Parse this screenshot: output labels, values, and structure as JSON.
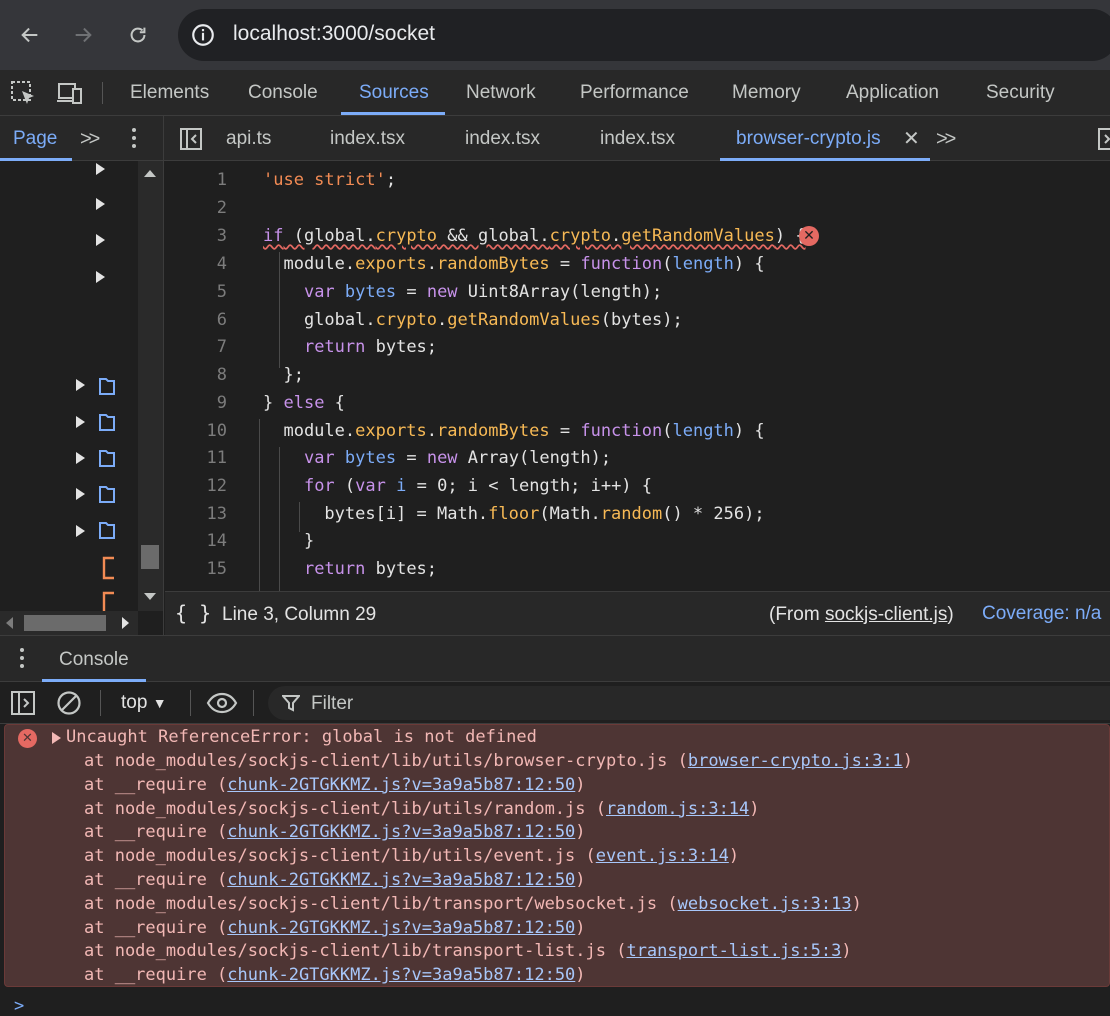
{
  "browser": {
    "url": "localhost:3000/socket"
  },
  "devtools": {
    "tabs": [
      "Elements",
      "Console",
      "Sources",
      "Network",
      "Performance",
      "Memory",
      "Application",
      "Security"
    ],
    "active_tab": "Sources"
  },
  "sources": {
    "navigator_tab": "Page",
    "open_files": [
      "api.ts",
      "index.tsx",
      "index.tsx",
      "index.tsx",
      "browser-crypto.js"
    ],
    "active_file": "browser-crypto.js"
  },
  "editor": {
    "line_numbers": [
      "1",
      "2",
      "3",
      "4",
      "5",
      "6",
      "7",
      "8",
      "9",
      "10",
      "11",
      "12",
      "13",
      "14",
      "15"
    ],
    "error_line": "3"
  },
  "status": {
    "braces": "{ }",
    "position": "Line 3, Column 29",
    "from_prefix": "(From ",
    "from_file": "sockjs-client.js",
    "from_suffix": ")",
    "coverage": "Coverage: n/a"
  },
  "drawer": {
    "tab": "Console",
    "context": "top",
    "filter_placeholder": "Filter"
  },
  "console": {
    "error_message": "Uncaught ReferenceError: global is not defined",
    "stack": [
      {
        "text": "at node_modules/sockjs-client/lib/utils/browser-crypto.js (",
        "link": "browser-crypto.js:3:1",
        "end": ")"
      },
      {
        "text": "at __require (",
        "link": "chunk-2GTGKKMZ.js?v=3a9a5b87:12:50",
        "end": ")"
      },
      {
        "text": "at node_modules/sockjs-client/lib/utils/random.js (",
        "link": "random.js:3:14",
        "end": ")"
      },
      {
        "text": "at __require (",
        "link": "chunk-2GTGKKMZ.js?v=3a9a5b87:12:50",
        "end": ")"
      },
      {
        "text": "at node_modules/sockjs-client/lib/utils/event.js (",
        "link": "event.js:3:14",
        "end": ")"
      },
      {
        "text": "at __require (",
        "link": "chunk-2GTGKKMZ.js?v=3a9a5b87:12:50",
        "end": ")"
      },
      {
        "text": "at node_modules/sockjs-client/lib/transport/websocket.js (",
        "link": "websocket.js:3:13",
        "end": ")"
      },
      {
        "text": "at __require (",
        "link": "chunk-2GTGKKMZ.js?v=3a9a5b87:12:50",
        "end": ")"
      },
      {
        "text": "at node_modules/sockjs-client/lib/transport-list.js (",
        "link": "transport-list.js:5:3",
        "end": ")"
      },
      {
        "text": "at __require (",
        "link": "chunk-2GTGKKMZ.js?v=3a9a5b87:12:50",
        "end": ")"
      }
    ],
    "prompt": ">"
  }
}
